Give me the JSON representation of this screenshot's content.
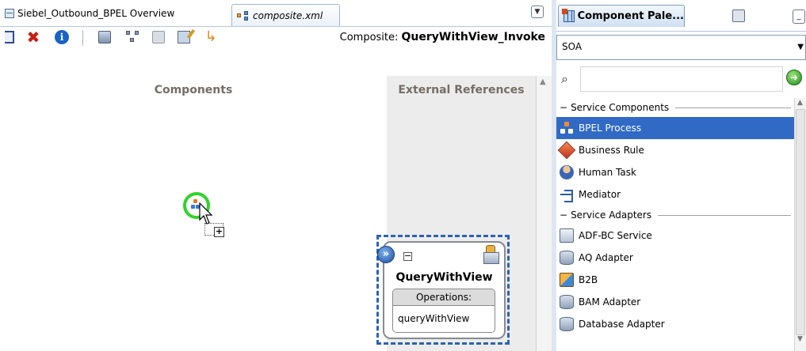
{
  "editor": {
    "tabs": [
      {
        "label": "Siebel_Outbound_BPEL Overview",
        "active": false
      },
      {
        "label": "composite.xml",
        "active": true
      }
    ],
    "toolbar_icons": [
      "document-icon",
      "delete-icon",
      "info-icon",
      "deploy-icon",
      "network-icon",
      "disabled-icon",
      "edit-icon",
      "arrow-icon"
    ],
    "composite_label": "Composite:",
    "composite_name": "QueryWithView_Invoke"
  },
  "canvas": {
    "components_title": "Components",
    "external_references_title": "External References",
    "reference": {
      "name": "QueryWithView",
      "operations_label": "Operations:",
      "operations": [
        "queryWithView"
      ]
    }
  },
  "palette": {
    "title": "Component Pale...",
    "category": "SOA",
    "search_value": "",
    "sections": [
      {
        "title": "Service Components",
        "items": [
          {
            "label": "BPEL Process",
            "icon": "bpel-process-icon",
            "selected": true
          },
          {
            "label": "Business Rule",
            "icon": "business-rule-icon",
            "selected": false
          },
          {
            "label": "Human Task",
            "icon": "human-task-icon",
            "selected": false
          },
          {
            "label": "Mediator",
            "icon": "mediator-icon",
            "selected": false
          }
        ]
      },
      {
        "title": "Service Adapters",
        "items": [
          {
            "label": "ADF-BC Service",
            "icon": "adf-bc-service-icon",
            "selected": false
          },
          {
            "label": "AQ Adapter",
            "icon": "aq-adapter-icon",
            "selected": false
          },
          {
            "label": "B2B",
            "icon": "b2b-icon",
            "selected": false
          },
          {
            "label": "BAM Adapter",
            "icon": "bam-adapter-icon",
            "selected": false
          },
          {
            "label": "Database Adapter",
            "icon": "database-adapter-icon",
            "selected": false
          }
        ]
      }
    ]
  },
  "colors": {
    "selection": "#316ac5",
    "drop_target_ring": "#31d22d",
    "reference_selection": "#2c62b3",
    "section_title": "#766d64"
  }
}
